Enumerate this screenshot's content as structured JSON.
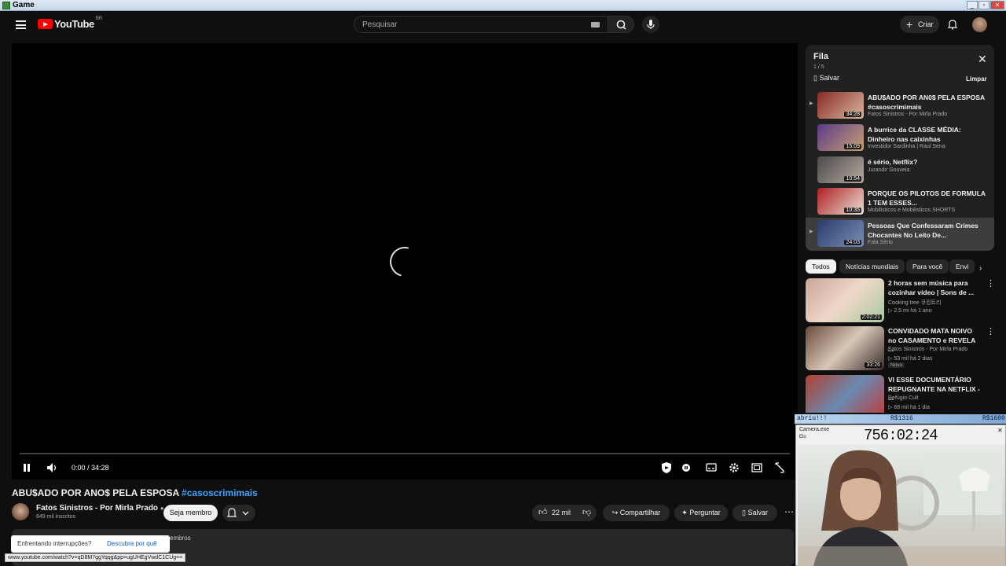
{
  "window": {
    "title": "Game"
  },
  "header": {
    "logo_text": "YouTube",
    "country_code": "BR",
    "search_placeholder": "Pesquisar",
    "create_label": "Criar"
  },
  "player": {
    "time_display": "0:00 / 34:28"
  },
  "video": {
    "title_main": "ABU$ADO POR ANO$ PELA ESPOSA ",
    "title_tag": "#casoscrimimais",
    "channel_name": "Fatos Sinistros - Por Mirla Prado",
    "subscribers": "849 mil inscritos",
    "join_label": "Seja membro",
    "likes": "22 mil",
    "share_label": "Compartilhar",
    "ask_label": "Perguntar",
    "save_label": "Salvar",
    "desc_partial": "embros"
  },
  "popup": {
    "question": "Enfrentando interrupções?",
    "link": "Descubra por quê"
  },
  "status_url": "www.youtube.com/watch?v=qD8M7ggYqqg&pp=ugUHEgVwdC1CUg==",
  "queue": {
    "title": "Fila",
    "count": "1 / 5",
    "save_label": "Salvar",
    "clear_label": "Limpar",
    "items": [
      {
        "title": "ABU$ADO POR AN0$ PELA ESPOSA #casoscrimimais",
        "channel": "Fatos Sinistros - Por Mirla Prado",
        "duration": "34:28",
        "thumb_color": "#8a2a24"
      },
      {
        "title": "A burrice da CLASSE MÉDIA: Dinheiro nas caixinhas",
        "channel": "Investidor Sardinha | Raul Sena",
        "duration": "15:09",
        "thumb_color": "#5a3a8a"
      },
      {
        "title": "é sério, Netflix?",
        "channel": "Jurandir Gouveia",
        "duration": "10:54",
        "thumb_color": "#5a5a5a"
      },
      {
        "title": "PORQUE OS PILOTOS DE FORMULA 1 TEM ESSES...",
        "channel": "Mobilisticos e Mobilisticos SHORTS",
        "duration": "10:35",
        "thumb_color": "#b02020"
      },
      {
        "title": "Pessoas Que Confessaram Crimes Chocantes No Leito De...",
        "channel": "Fala Sério",
        "duration": "24:03",
        "thumb_color": "#2a3a6a"
      }
    ]
  },
  "chips": [
    "Todos",
    "Notícias mundiais",
    "Para você",
    "Envi"
  ],
  "recommendations": [
    {
      "title": "2 horas sem música para cozinhar vídeo | Sons de ...",
      "channel": "Cooking tree 쿠킹트리",
      "meta": "▷ 2,5 mi  há 1 ano",
      "duration": "2:02:21",
      "badge": "",
      "thumb_color": "#c9a69a"
    },
    {
      "title": "CONVIDADO MATA NOIVO no CASAMENTO e REVELA ...",
      "channel": "Fatos Sinistros - Por Mirla Prado",
      "meta": "▷ 53 mil  há 2 dias",
      "duration": "33:26",
      "badge": "Novo",
      "thumb_color": "#6a4a3a"
    },
    {
      "title": "VI ESSE DOCUMENTÁRIO REPUGNANTE NA NETFLIX - ...",
      "channel": "Refúgio Cult",
      "meta": "▷ 68 mil  há 1 dia",
      "duration": "",
      "badge": "",
      "thumb_color": "#b04030"
    }
  ],
  "overlay": {
    "label": "abriu!!!",
    "value_mid": "R$1316",
    "value_right": "R$1600",
    "app_name": "Camera.exe",
    "sub_label": "Elo",
    "timer": "756:02:24"
  },
  "colors": {
    "background": "#0f0f0f",
    "accent_red": "#ff0000",
    "link_blue": "#3ea6ff"
  }
}
